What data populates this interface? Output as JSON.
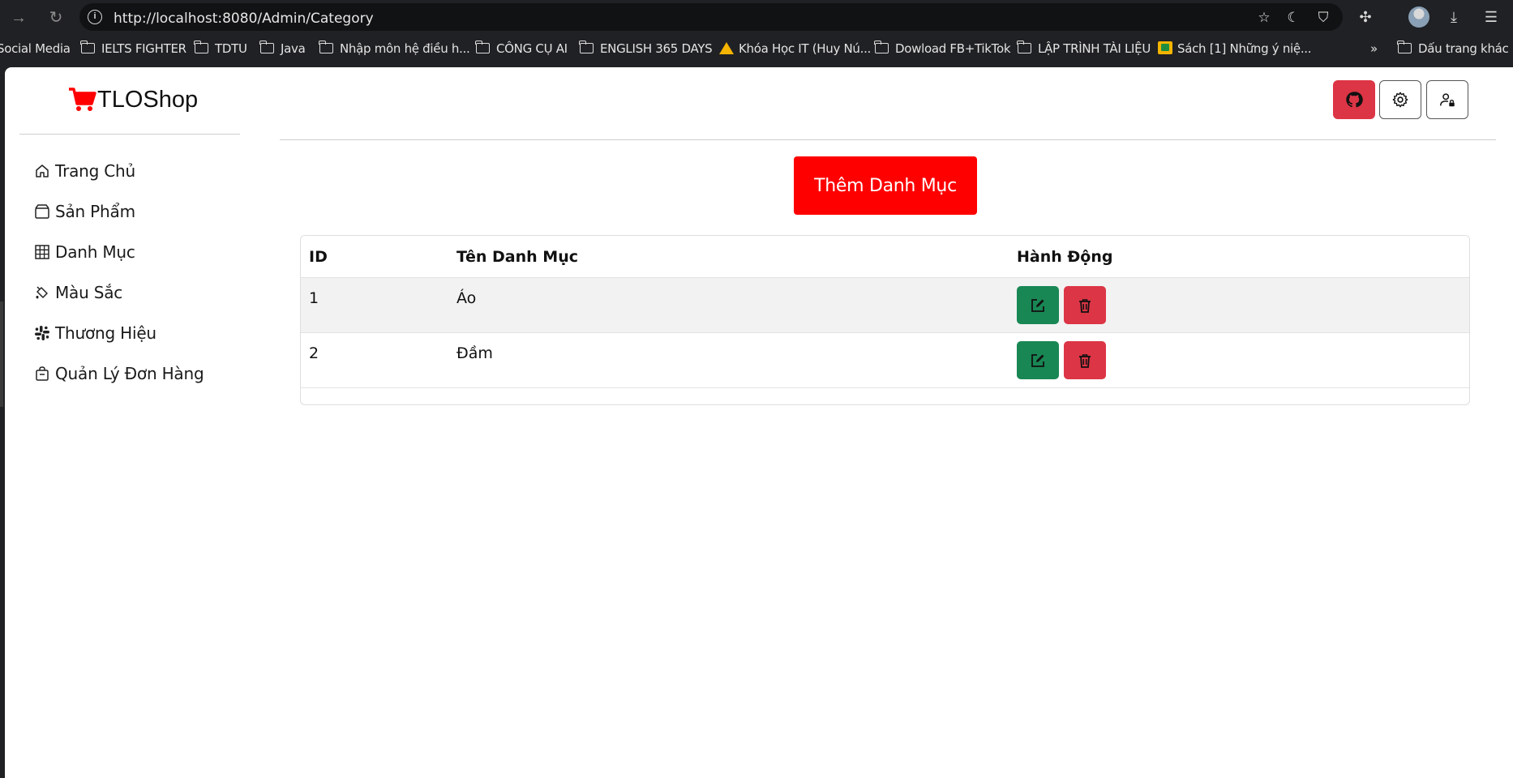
{
  "browser": {
    "url": "http://localhost:8080/Admin/Category",
    "bookmarks": [
      {
        "label": "Social Media",
        "icon": "none"
      },
      {
        "label": "IELTS FIGHTER",
        "icon": "folder-icon"
      },
      {
        "label": "TDTU",
        "icon": "folder-icon"
      },
      {
        "label": "Java",
        "icon": "folder-icon"
      },
      {
        "label": "Nhập môn hệ điều h...",
        "icon": "folder-icon"
      },
      {
        "label": "CÔNG CỤ AI",
        "icon": "folder-icon"
      },
      {
        "label": "ENGLISH 365 DAYS",
        "icon": "folder-icon"
      },
      {
        "label": "Khóa Học IT (Huy Nú...",
        "icon": "drive-icon"
      },
      {
        "label": "Dowload FB+TikTok",
        "icon": "folder-icon"
      },
      {
        "label": "LẬP TRÌNH TÀI LIỆU",
        "icon": "folder-icon"
      },
      {
        "label": "Sách [1] Những ý niệ...",
        "icon": "classroom-icon"
      }
    ],
    "overflow_label": "»",
    "other_bookmarks": "Dấu trang khác"
  },
  "app": {
    "brand": "TLOShop",
    "brand_color": "#ff0000",
    "sidebar": [
      {
        "label": "Trang Chủ",
        "icon": "house-icon"
      },
      {
        "label": "Sản Phẩm",
        "icon": "box-icon"
      },
      {
        "label": "Danh Mục",
        "icon": "grid-icon"
      },
      {
        "label": "Màu Sắc",
        "icon": "paint-bucket-icon"
      },
      {
        "label": "Thương Hiệu",
        "icon": "slack-icon"
      },
      {
        "label": "Quản Lý Đơn Hàng",
        "icon": "bag-icon"
      }
    ],
    "top_actions": [
      {
        "name": "github-icon",
        "color": "#dc3545"
      },
      {
        "name": "gear-icon",
        "color": "#ffffff"
      },
      {
        "name": "user-lock-icon",
        "color": "#ffffff"
      }
    ],
    "add_button": "Thêm Danh Mục",
    "add_button_color": "#ff0000",
    "table": {
      "headers": [
        "ID",
        "Tên Danh Mục",
        "Hành Động"
      ],
      "rows": [
        {
          "id": "1",
          "name": "Áo"
        },
        {
          "id": "2",
          "name": "Đầm"
        }
      ],
      "edit_color": "#198754",
      "delete_color": "#dc3545"
    }
  }
}
